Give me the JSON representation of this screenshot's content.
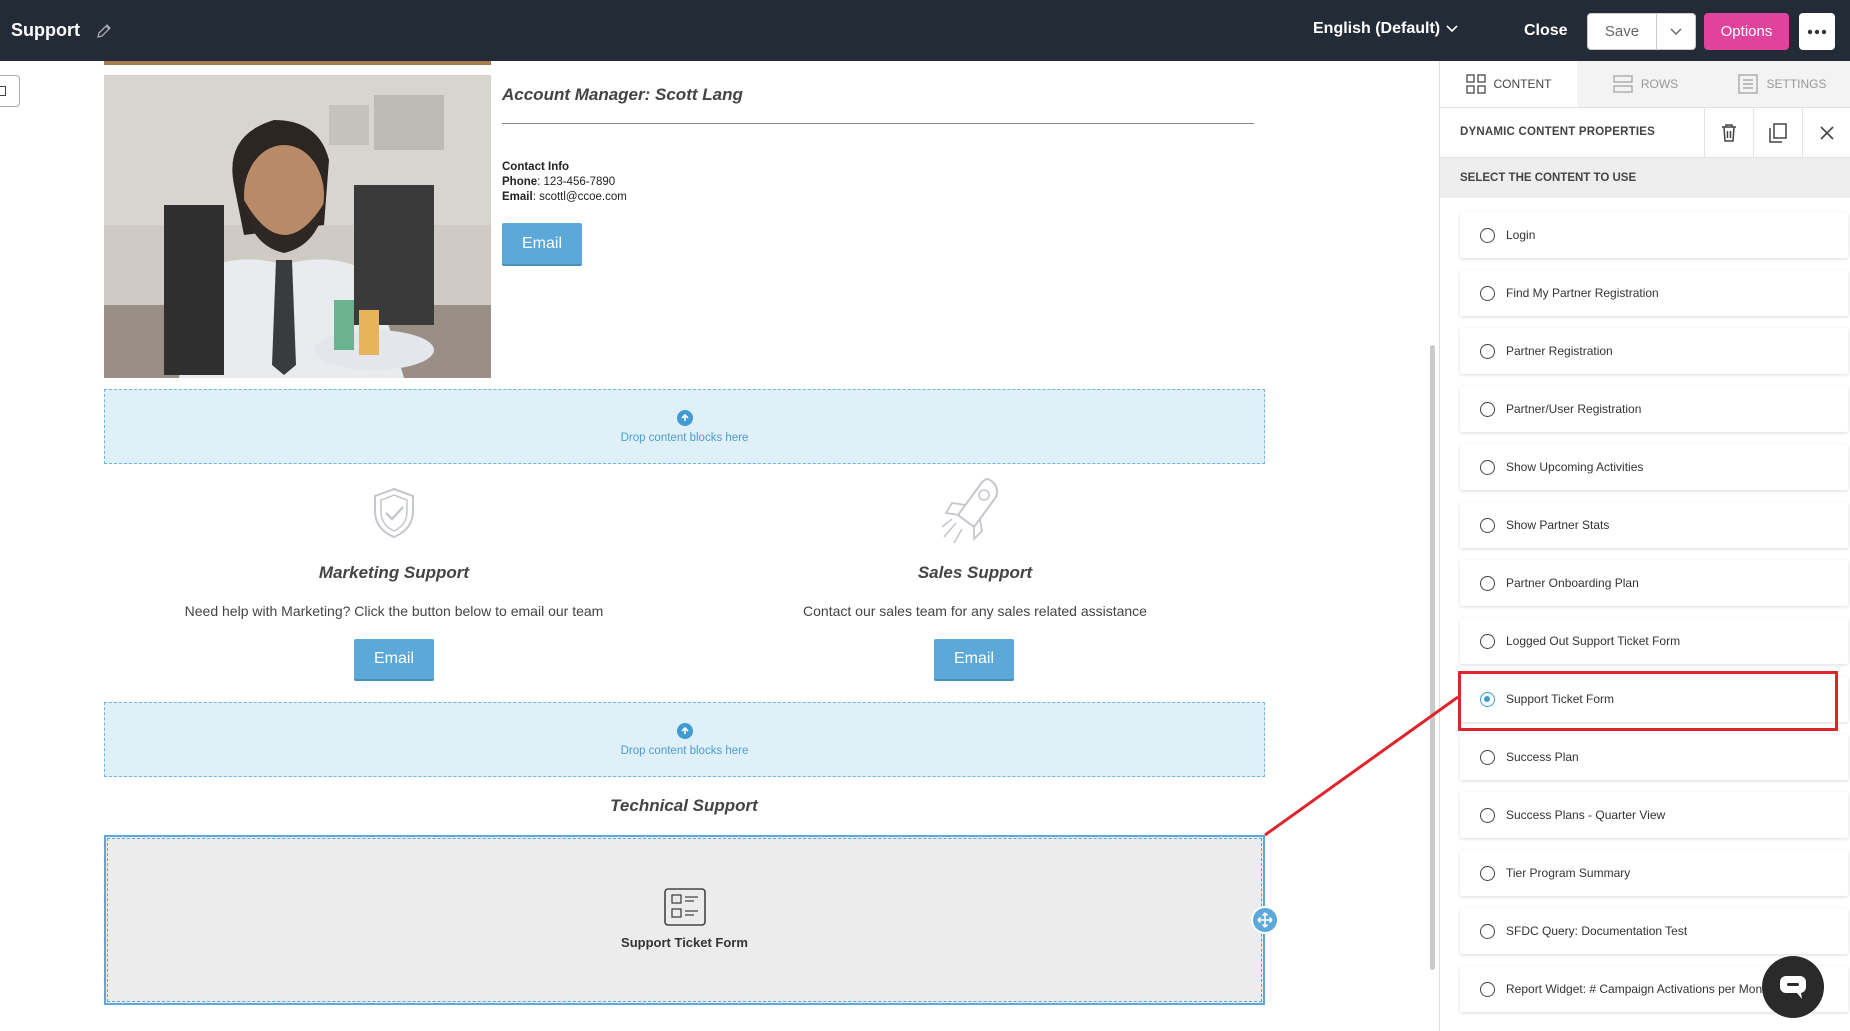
{
  "topbar": {
    "title": "Support",
    "language": "English (Default)",
    "close_label": "Close",
    "save_label": "Save",
    "options_label": "Options"
  },
  "content": {
    "account_manager_title": "Account Manager: Scott Lang",
    "contact_info_label": "Contact Info",
    "phone_label": "Phone",
    "phone_value": ": 123-456-7890",
    "email_label": "Email",
    "email_value": ": scottl@ccoe.com",
    "email_button": "Email",
    "drop_text": "Drop content blocks here",
    "marketing_title": "Marketing Support",
    "marketing_desc": "Need help with Marketing? Click the button below to email our team",
    "sales_title": "Sales Support",
    "sales_desc": "Contact our sales team for any sales related assistance",
    "technical_title": "Technical Support",
    "ticket_block_label": "Support Ticket Form"
  },
  "panel": {
    "tabs": [
      {
        "label": "CONTENT",
        "active": true
      },
      {
        "label": "ROWS",
        "active": false
      },
      {
        "label": "SETTINGS",
        "active": false
      }
    ],
    "properties_title": "DYNAMIC CONTENT PROPERTIES",
    "select_title": "SELECT THE CONTENT TO USE",
    "options": [
      {
        "label": "Login",
        "selected": false
      },
      {
        "label": "Find My Partner Registration",
        "selected": false
      },
      {
        "label": "Partner Registration",
        "selected": false
      },
      {
        "label": "Partner/User Registration",
        "selected": false
      },
      {
        "label": "Show Upcoming Activities",
        "selected": false
      },
      {
        "label": "Show Partner Stats",
        "selected": false
      },
      {
        "label": "Partner Onboarding Plan",
        "selected": false
      },
      {
        "label": "Logged Out Support Ticket Form",
        "selected": false
      },
      {
        "label": "Support Ticket Form",
        "selected": true
      },
      {
        "label": "Success Plan",
        "selected": false
      },
      {
        "label": "Success Plans - Quarter View",
        "selected": false
      },
      {
        "label": "Tier Program Summary",
        "selected": false
      },
      {
        "label": "SFDC Query: Documentation Test",
        "selected": false
      },
      {
        "label": "Report Widget: # Campaign Activations per Month",
        "selected": false
      }
    ]
  },
  "colors": {
    "topbar_bg": "#232b37",
    "options_accent": "#e0439b",
    "email_button": "#5ba8d9",
    "dropzone_bg": "#e0f0f9",
    "highlight": "#e0242c",
    "radio_selected": "#3f9bd2"
  },
  "icons": [
    "pencil-icon",
    "chevron-down-icon",
    "more-dots-icon",
    "grid-icon",
    "rows-icon",
    "settings-icon",
    "trash-icon",
    "copy-icon",
    "close-icon",
    "upload-arrow-icon",
    "shield-check-icon",
    "rocket-icon",
    "form-icon",
    "move-icon",
    "chat-icon"
  ]
}
